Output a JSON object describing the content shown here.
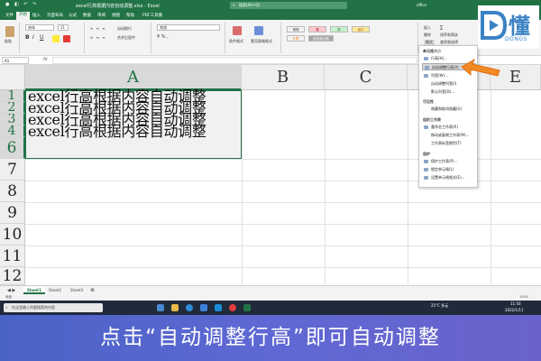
{
  "window": {
    "title": "excel行高根据内容自动调整.xlsx - Excel",
    "search_placeholder": "搜索(Alt+Q)",
    "user": "office"
  },
  "tabs": [
    "文件",
    "开始",
    "插入",
    "页面布局",
    "公式",
    "数据",
    "审阅",
    "视图",
    "帮助",
    "PDF工具集"
  ],
  "active_tab": "开始",
  "ribbon": {
    "paste_label": "粘贴",
    "font_name": "宋体",
    "font_size": "11",
    "wrap_label": "自动换行",
    "merge_label": "合并后居中",
    "number_format": "常规",
    "conditional_label": "条件格式",
    "table_label": "套用表格格式",
    "styles": [
      {
        "label": "常规",
        "bg": "#ffffff",
        "color": "#222222"
      },
      {
        "label": "差",
        "bg": "#ffc7ce",
        "color": "#9c0006"
      },
      {
        "label": "好",
        "bg": "#c6efce",
        "color": "#006100"
      },
      {
        "label": "适中",
        "bg": "#ffeb9c",
        "color": "#9c5700"
      },
      {
        "label": "计算",
        "bg": "#f2f2f2",
        "color": "#fa7d00"
      },
      {
        "label": "检查单元格",
        "bg": "#a5a5a5",
        "color": "#ffffff"
      }
    ],
    "insert_label": "插入",
    "delete_label": "删除",
    "format_label": "格式",
    "sum_label": "∑",
    "sort_label": "排序和筛选",
    "find_label": "查找和选择"
  },
  "formula_bar": {
    "name_box": "A1",
    "fx": "fx"
  },
  "columns": [
    "A",
    "B",
    "C",
    "D",
    "E"
  ],
  "rows": [
    "1",
    "2",
    "3",
    "4",
    "6",
    "7",
    "8",
    "9",
    "10",
    "11",
    "12"
  ],
  "cells": [
    "excel行高根据内容自动调整",
    "excel行高根据内容自动调整",
    "excel行高根据内容自动调整",
    "excel行高根据内容自动调整"
  ],
  "context_menu": {
    "sections": [
      {
        "header": "单元格大小",
        "items": [
          "行高(H)...",
          "自动调整行高(A)",
          "列宽(W)...",
          "自动调整列宽(I)",
          "默认列宽(D)..."
        ]
      },
      {
        "header": "可见性",
        "items": [
          "隐藏和取消隐藏(U)"
        ]
      },
      {
        "header": "组织工作表",
        "items": [
          "重命名工作表(R)",
          "移动或复制工作表(M)...",
          "工作表标签颜色(T)"
        ]
      },
      {
        "header": "保护",
        "items": [
          "保护工作表(P)...",
          "锁定单元格(L)",
          "设置单元格格式(E)..."
        ]
      }
    ],
    "highlighted_item": "自动调整行高(A)"
  },
  "sheet_tabs": [
    "Sheet1",
    "Sheet2",
    "Sheet3"
  ],
  "active_sheet": "Sheet1",
  "status": {
    "ready": "就绪",
    "zoom": "100%"
  },
  "taskbar": {
    "search_text": "在这里输入你要搜索的内容",
    "weather": "25°C 多云",
    "time": "11:50",
    "date": "2022/1/11"
  },
  "caption": "点击“自动调整行高”即可自动调整",
  "logo": {
    "text": "懂",
    "sub": "DONGS"
  },
  "colors": {
    "excel_green": "#217346",
    "caption_bg": "#5a66cf",
    "arrow": "#f08a24"
  }
}
